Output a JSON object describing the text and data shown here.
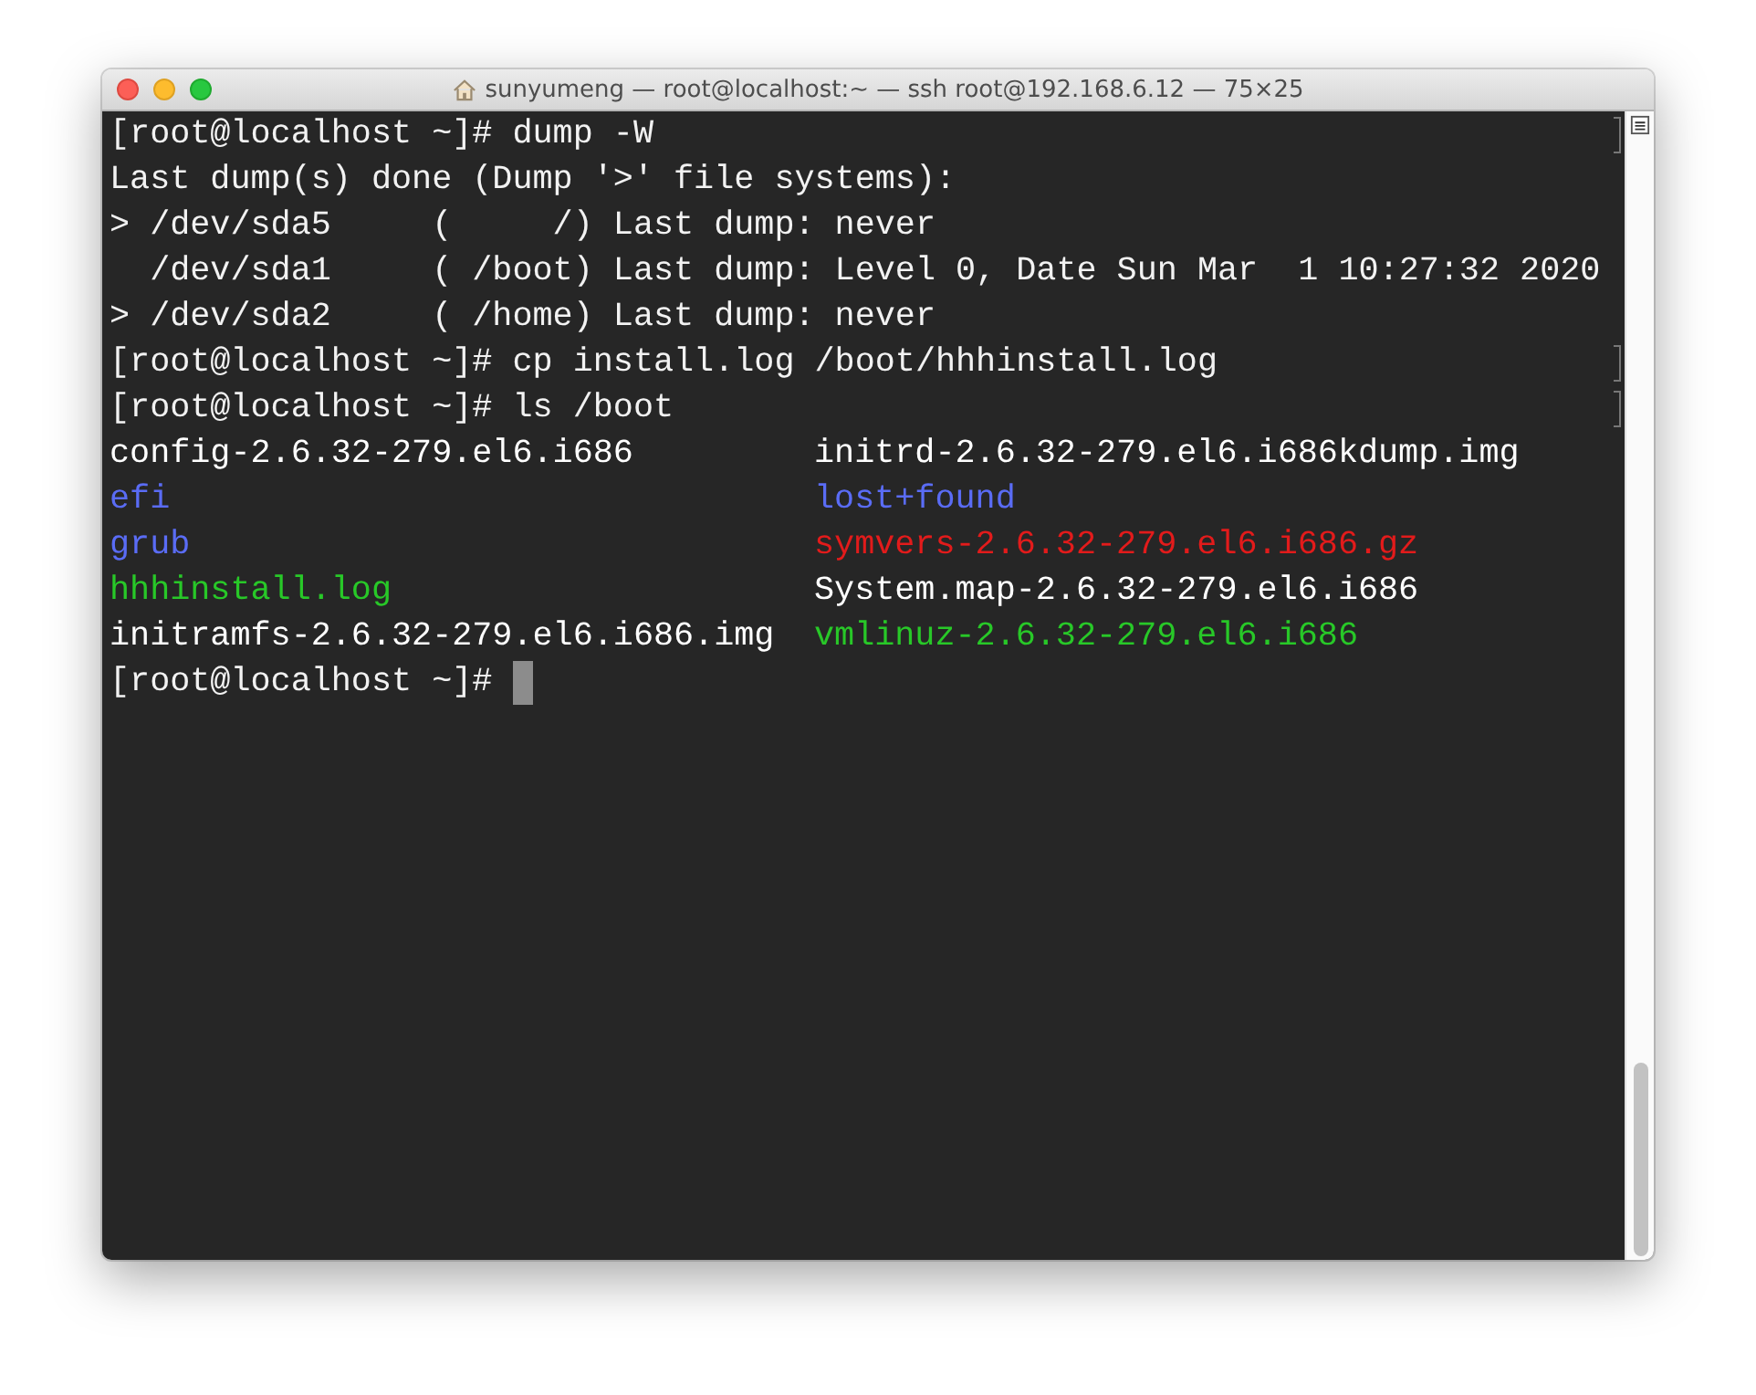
{
  "window": {
    "title": "sunyumeng — root@localhost:~ — ssh root@192.168.6.12 — 75×25"
  },
  "lines": [
    {
      "text": "[root@localhost ~]# dump -W",
      "marked": true
    },
    {
      "text": "Last dump(s) done (Dump '>' file systems):",
      "marked": false
    },
    {
      "text": "> /dev/sda5     (     /) Last dump: never",
      "marked": false
    },
    {
      "text": "  /dev/sda1     ( /boot) Last dump: Level 0, Date Sun Mar  1 10:27:32 2020",
      "marked": false
    },
    {
      "text": "> /dev/sda2     ( /home) Last dump: never",
      "marked": false
    },
    {
      "text": "[root@localhost ~]# cp install.log /boot/hhhinstall.log",
      "marked": true
    },
    {
      "text": "[root@localhost ~]# ls /boot",
      "marked": true
    }
  ],
  "listing": [
    {
      "name": "config-2.6.32-279.el6.i686",
      "color": "#ffffff"
    },
    {
      "name": "efi",
      "color": "#5a6cf5"
    },
    {
      "name": "grub",
      "color": "#5a6cf5"
    },
    {
      "name": "hhhinstall.log",
      "color": "#28c828"
    },
    {
      "name": "initramfs-2.6.32-279.el6.i686.img",
      "color": "#ffffff"
    },
    {
      "name": "initrd-2.6.32-279.el6.i686kdump.img",
      "color": "#ffffff"
    },
    {
      "name": "lost+found",
      "color": "#5a6cf5"
    },
    {
      "name": "symvers-2.6.32-279.el6.i686.gz",
      "color": "#e21b1b"
    },
    {
      "name": "System.map-2.6.32-279.el6.i686",
      "color": "#ffffff"
    },
    {
      "name": "vmlinuz-2.6.32-279.el6.i686",
      "color": "#28c828"
    }
  ],
  "prompt": {
    "text": "[root@localhost ~]#"
  }
}
